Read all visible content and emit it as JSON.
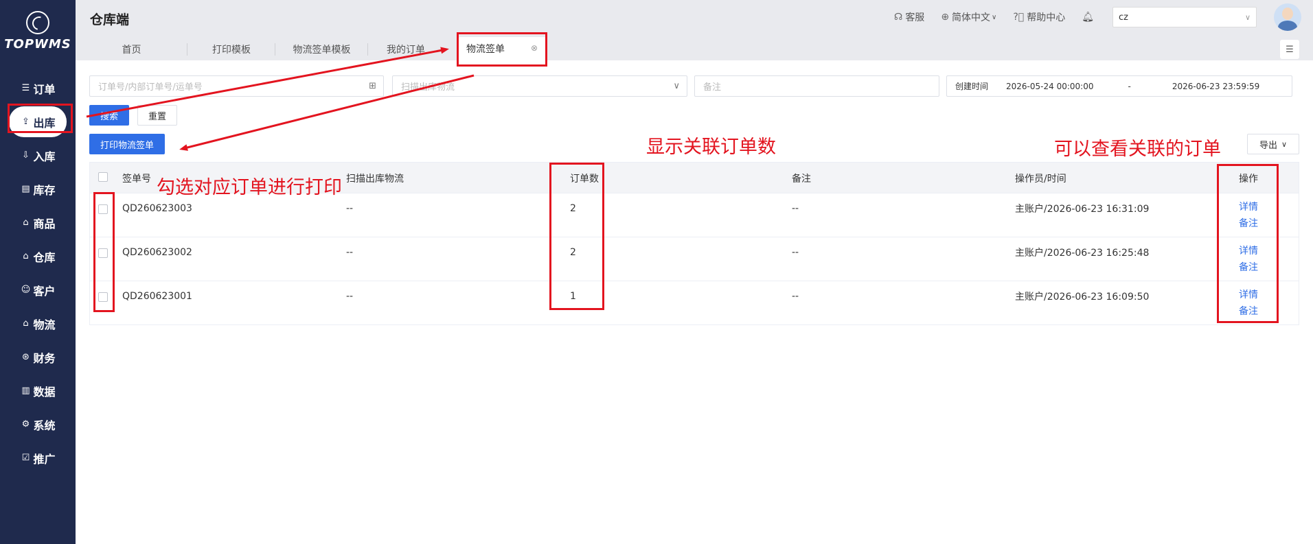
{
  "logo": {
    "text": "TOPWMS"
  },
  "sidebar": {
    "items": [
      {
        "label": "订单",
        "icon": "list-icon"
      },
      {
        "label": "出库",
        "icon": "outbound-icon",
        "active": true
      },
      {
        "label": "入库",
        "icon": "inbound-icon"
      },
      {
        "label": "库存",
        "icon": "inventory-icon"
      },
      {
        "label": "商品",
        "icon": "bag-icon"
      },
      {
        "label": "仓库",
        "icon": "warehouse-icon"
      },
      {
        "label": "客户",
        "icon": "user-icon"
      },
      {
        "label": "物流",
        "icon": "truck-icon"
      },
      {
        "label": "财务",
        "icon": "finance-icon"
      },
      {
        "label": "数据",
        "icon": "chart-icon"
      },
      {
        "label": "系统",
        "icon": "gear-icon"
      },
      {
        "label": "推广",
        "icon": "promo-icon"
      }
    ]
  },
  "header": {
    "title": "仓库端",
    "service": "客服",
    "language": "简体中文",
    "help": "帮助中心",
    "account": "cz"
  },
  "tabs": [
    {
      "label": "首页"
    },
    {
      "label": "打印模板"
    },
    {
      "label": "物流签单模板"
    },
    {
      "label": "我的订单"
    },
    {
      "label": "物流签单",
      "active": true
    }
  ],
  "filters": {
    "order_placeholder": "订单号/内部订单号/运单号",
    "logistics_placeholder": "扫描出库物流",
    "remark_placeholder": "备注",
    "date_label": "创建时间",
    "date_start": "2026-05-24 00:00:00",
    "date_sep": "-",
    "date_end": "2026-06-23 23:59:59"
  },
  "buttons": {
    "search": "搜索",
    "reset": "重置",
    "print": "打印物流签单",
    "export": "导出"
  },
  "table": {
    "columns": [
      "签单号",
      "扫描出库物流",
      "订单数",
      "备注",
      "操作员/时间",
      "操作"
    ],
    "rows": [
      {
        "id": "QD260623003",
        "logistics": "--",
        "orders": "2",
        "remark": "--",
        "operator": "主账户/2026-06-23 16:31:09"
      },
      {
        "id": "QD260623002",
        "logistics": "--",
        "orders": "2",
        "remark": "--",
        "operator": "主账户/2026-06-23 16:25:48"
      },
      {
        "id": "QD260623001",
        "logistics": "--",
        "orders": "1",
        "remark": "--",
        "operator": "主账户/2026-06-23 16:09:50"
      }
    ],
    "action_detail": "详情",
    "action_remark": "备注"
  },
  "annotations": {
    "select_print": "勾选对应订单进行打印",
    "show_count": "显示关联订单数",
    "view_orders": "可以查看关联的订单"
  },
  "colors": {
    "sidebar": "#1f2a4d",
    "primary": "#2f6ee6",
    "annotation": "#e3141f"
  }
}
